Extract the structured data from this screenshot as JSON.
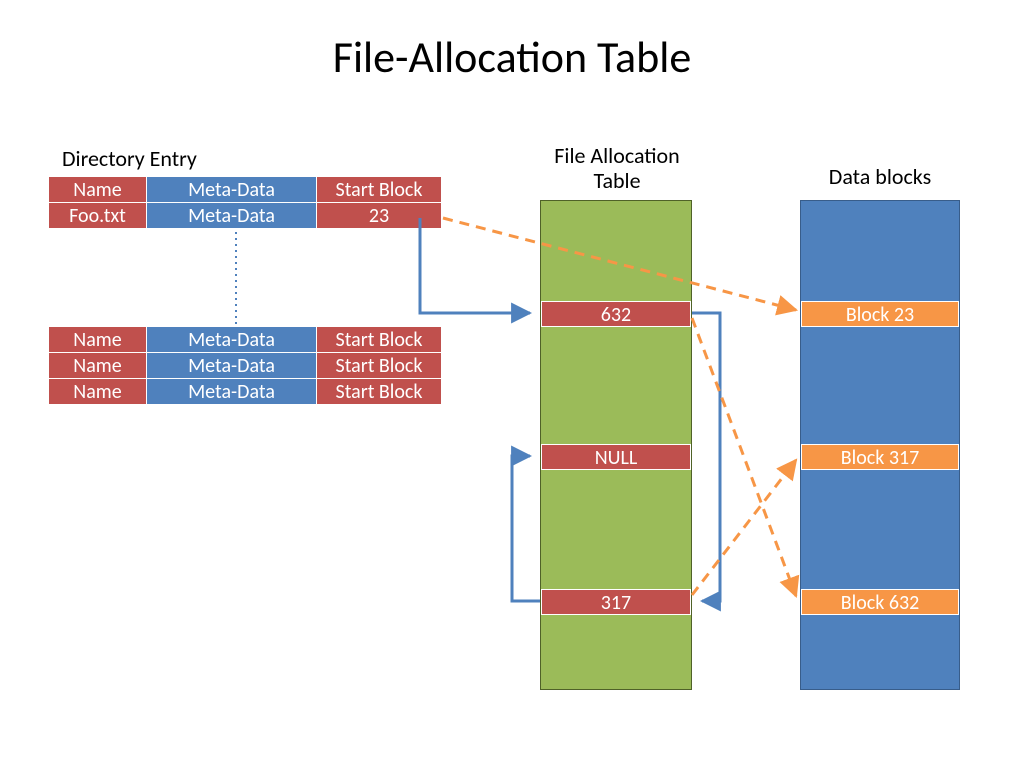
{
  "title": "File-Allocation Table",
  "labels": {
    "directory_entry": "Directory Entry",
    "fat": "File Allocation Table",
    "data_blocks": "Data blocks"
  },
  "dir1": {
    "row0": {
      "name": "Name",
      "meta": "Meta-Data",
      "start": "Start Block"
    },
    "row1": {
      "name": "Foo.txt",
      "meta": "Meta-Data",
      "start": "23"
    }
  },
  "dir2": {
    "row0": {
      "name": "Name",
      "meta": "Meta-Data",
      "start": "Start Block"
    },
    "row1": {
      "name": "Name",
      "meta": "Meta-Data",
      "start": "Start Block"
    },
    "row2": {
      "name": "Name",
      "meta": "Meta-Data",
      "start": "Start Block"
    }
  },
  "fat_slots": {
    "s0": "632",
    "s1": "NULL",
    "s2": "317"
  },
  "data_slots": {
    "d0": "Block 23",
    "d1": "Block 317",
    "d2": "Block 632"
  },
  "colors": {
    "red": "#c0504d",
    "blue": "#4f81bd",
    "green": "#9bbb59",
    "orange": "#f79646",
    "arrow_blue": "#4f81bd",
    "arrow_orange": "#f79646"
  }
}
